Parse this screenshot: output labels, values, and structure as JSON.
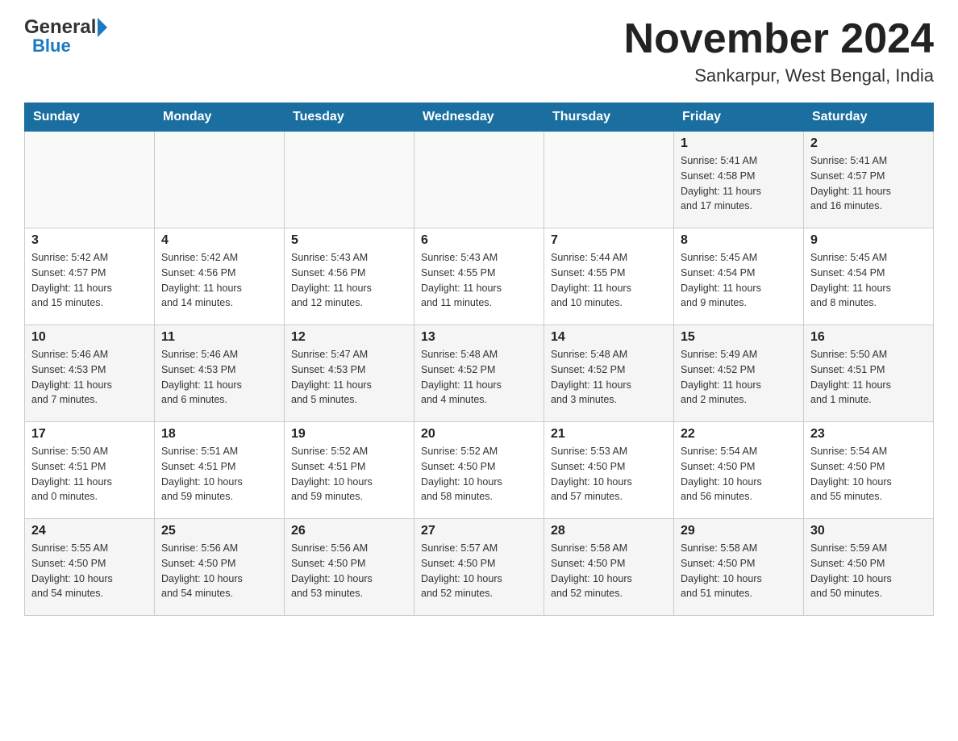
{
  "header": {
    "logo": {
      "general": "General",
      "blue": "Blue"
    },
    "title": "November 2024",
    "location": "Sankarpur, West Bengal, India"
  },
  "calendar": {
    "days_of_week": [
      "Sunday",
      "Monday",
      "Tuesday",
      "Wednesday",
      "Thursday",
      "Friday",
      "Saturday"
    ],
    "weeks": [
      [
        {
          "day": "",
          "info": ""
        },
        {
          "day": "",
          "info": ""
        },
        {
          "day": "",
          "info": ""
        },
        {
          "day": "",
          "info": ""
        },
        {
          "day": "",
          "info": ""
        },
        {
          "day": "1",
          "info": "Sunrise: 5:41 AM\nSunset: 4:58 PM\nDaylight: 11 hours\nand 17 minutes."
        },
        {
          "day": "2",
          "info": "Sunrise: 5:41 AM\nSunset: 4:57 PM\nDaylight: 11 hours\nand 16 minutes."
        }
      ],
      [
        {
          "day": "3",
          "info": "Sunrise: 5:42 AM\nSunset: 4:57 PM\nDaylight: 11 hours\nand 15 minutes."
        },
        {
          "day": "4",
          "info": "Sunrise: 5:42 AM\nSunset: 4:56 PM\nDaylight: 11 hours\nand 14 minutes."
        },
        {
          "day": "5",
          "info": "Sunrise: 5:43 AM\nSunset: 4:56 PM\nDaylight: 11 hours\nand 12 minutes."
        },
        {
          "day": "6",
          "info": "Sunrise: 5:43 AM\nSunset: 4:55 PM\nDaylight: 11 hours\nand 11 minutes."
        },
        {
          "day": "7",
          "info": "Sunrise: 5:44 AM\nSunset: 4:55 PM\nDaylight: 11 hours\nand 10 minutes."
        },
        {
          "day": "8",
          "info": "Sunrise: 5:45 AM\nSunset: 4:54 PM\nDaylight: 11 hours\nand 9 minutes."
        },
        {
          "day": "9",
          "info": "Sunrise: 5:45 AM\nSunset: 4:54 PM\nDaylight: 11 hours\nand 8 minutes."
        }
      ],
      [
        {
          "day": "10",
          "info": "Sunrise: 5:46 AM\nSunset: 4:53 PM\nDaylight: 11 hours\nand 7 minutes."
        },
        {
          "day": "11",
          "info": "Sunrise: 5:46 AM\nSunset: 4:53 PM\nDaylight: 11 hours\nand 6 minutes."
        },
        {
          "day": "12",
          "info": "Sunrise: 5:47 AM\nSunset: 4:53 PM\nDaylight: 11 hours\nand 5 minutes."
        },
        {
          "day": "13",
          "info": "Sunrise: 5:48 AM\nSunset: 4:52 PM\nDaylight: 11 hours\nand 4 minutes."
        },
        {
          "day": "14",
          "info": "Sunrise: 5:48 AM\nSunset: 4:52 PM\nDaylight: 11 hours\nand 3 minutes."
        },
        {
          "day": "15",
          "info": "Sunrise: 5:49 AM\nSunset: 4:52 PM\nDaylight: 11 hours\nand 2 minutes."
        },
        {
          "day": "16",
          "info": "Sunrise: 5:50 AM\nSunset: 4:51 PM\nDaylight: 11 hours\nand 1 minute."
        }
      ],
      [
        {
          "day": "17",
          "info": "Sunrise: 5:50 AM\nSunset: 4:51 PM\nDaylight: 11 hours\nand 0 minutes."
        },
        {
          "day": "18",
          "info": "Sunrise: 5:51 AM\nSunset: 4:51 PM\nDaylight: 10 hours\nand 59 minutes."
        },
        {
          "day": "19",
          "info": "Sunrise: 5:52 AM\nSunset: 4:51 PM\nDaylight: 10 hours\nand 59 minutes."
        },
        {
          "day": "20",
          "info": "Sunrise: 5:52 AM\nSunset: 4:50 PM\nDaylight: 10 hours\nand 58 minutes."
        },
        {
          "day": "21",
          "info": "Sunrise: 5:53 AM\nSunset: 4:50 PM\nDaylight: 10 hours\nand 57 minutes."
        },
        {
          "day": "22",
          "info": "Sunrise: 5:54 AM\nSunset: 4:50 PM\nDaylight: 10 hours\nand 56 minutes."
        },
        {
          "day": "23",
          "info": "Sunrise: 5:54 AM\nSunset: 4:50 PM\nDaylight: 10 hours\nand 55 minutes."
        }
      ],
      [
        {
          "day": "24",
          "info": "Sunrise: 5:55 AM\nSunset: 4:50 PM\nDaylight: 10 hours\nand 54 minutes."
        },
        {
          "day": "25",
          "info": "Sunrise: 5:56 AM\nSunset: 4:50 PM\nDaylight: 10 hours\nand 54 minutes."
        },
        {
          "day": "26",
          "info": "Sunrise: 5:56 AM\nSunset: 4:50 PM\nDaylight: 10 hours\nand 53 minutes."
        },
        {
          "day": "27",
          "info": "Sunrise: 5:57 AM\nSunset: 4:50 PM\nDaylight: 10 hours\nand 52 minutes."
        },
        {
          "day": "28",
          "info": "Sunrise: 5:58 AM\nSunset: 4:50 PM\nDaylight: 10 hours\nand 52 minutes."
        },
        {
          "day": "29",
          "info": "Sunrise: 5:58 AM\nSunset: 4:50 PM\nDaylight: 10 hours\nand 51 minutes."
        },
        {
          "day": "30",
          "info": "Sunrise: 5:59 AM\nSunset: 4:50 PM\nDaylight: 10 hours\nand 50 minutes."
        }
      ]
    ]
  }
}
